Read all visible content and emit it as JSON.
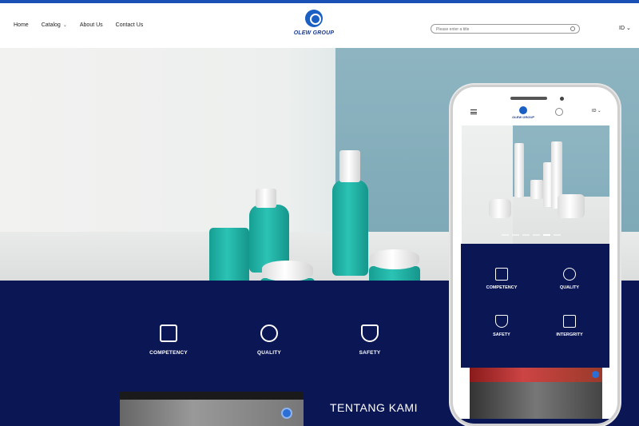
{
  "header": {
    "nav": [
      {
        "label": "Home"
      },
      {
        "label": "Catalog",
        "has_dropdown": true
      },
      {
        "label": "About Us"
      },
      {
        "label": "Contact Us"
      }
    ],
    "logo_text": "OLEW GROUP",
    "search_placeholder": "Please enter a title",
    "language": "ID"
  },
  "features": [
    {
      "label": "COMPETENCY",
      "icon": "checklist-icon"
    },
    {
      "label": "QUALITY",
      "icon": "badge-icon"
    },
    {
      "label": "SAFETY",
      "icon": "shield-icon"
    }
  ],
  "about": {
    "title": "TENTANG KAMI"
  },
  "phone": {
    "logo_text": "OLEW GROUP",
    "language": "ID",
    "features": [
      {
        "label": "COMPETENCY",
        "icon": "checklist-icon"
      },
      {
        "label": "QUALITY",
        "icon": "badge-icon"
      },
      {
        "label": "SAFETY",
        "icon": "shield-icon"
      },
      {
        "label": "INTERGRITY",
        "icon": "handshake-icon"
      }
    ]
  },
  "colors": {
    "accent": "#1a4fb5",
    "navy": "#0b1654",
    "teal": "#1fb3a5"
  }
}
